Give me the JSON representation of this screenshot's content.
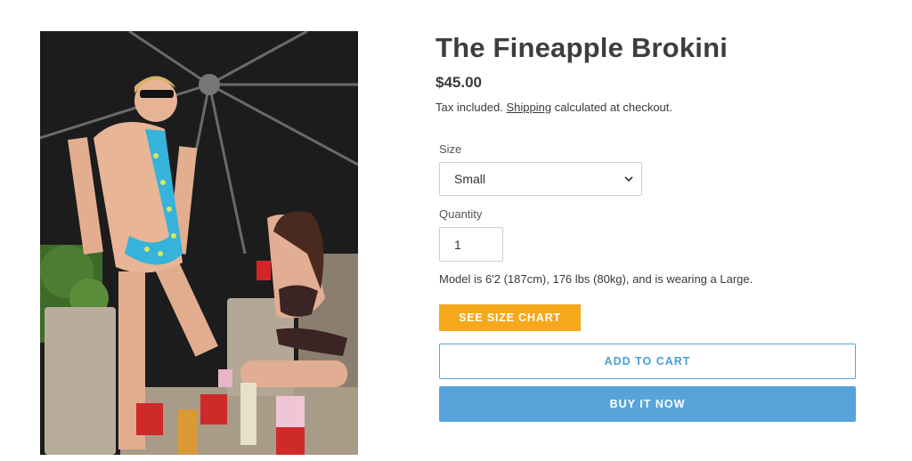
{
  "product": {
    "title": "The Fineapple Brokini",
    "price": "$45.00",
    "tax_prefix": "Tax included.",
    "shipping_link": "Shipping",
    "tax_suffix": "calculated at checkout.",
    "image_description": "Model in pineapple-print sling swimsuit posing under a patio umbrella with a woman holding a red cup"
  },
  "options": {
    "size_label": "Size",
    "size_value": "Small",
    "quantity_label": "Quantity",
    "quantity_value": "1"
  },
  "model_note": "Model is 6'2 (187cm), 176 lbs (80kg), and is wearing a Large.",
  "buttons": {
    "size_chart": "SEE SIZE CHART",
    "add_to_cart": "ADD TO CART",
    "buy_now": "BUY IT NOW"
  },
  "colors": {
    "accent_orange": "#f5a81a",
    "accent_blue": "#58a4da"
  }
}
